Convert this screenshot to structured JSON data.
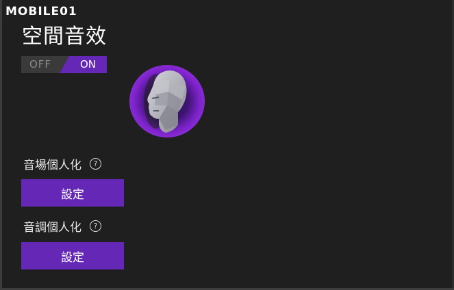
{
  "watermark": {
    "text": "MOBILE01"
  },
  "page": {
    "title": "空間音效"
  },
  "spatial_toggle": {
    "off_label": "OFF",
    "on_label": "ON",
    "state": "ON"
  },
  "sections": [
    {
      "label": "音場個人化",
      "help_icon": "?",
      "button_label": "設定"
    },
    {
      "label": "音調個人化",
      "help_icon": "?",
      "button_label": "設定"
    }
  ],
  "colors": {
    "accent": "#6527b6",
    "background": "#1f1f1f",
    "toggle_off_bg": "#3a3a3a"
  },
  "icons": {
    "head": "3d-head-icon",
    "help": "question-circle-icon"
  }
}
